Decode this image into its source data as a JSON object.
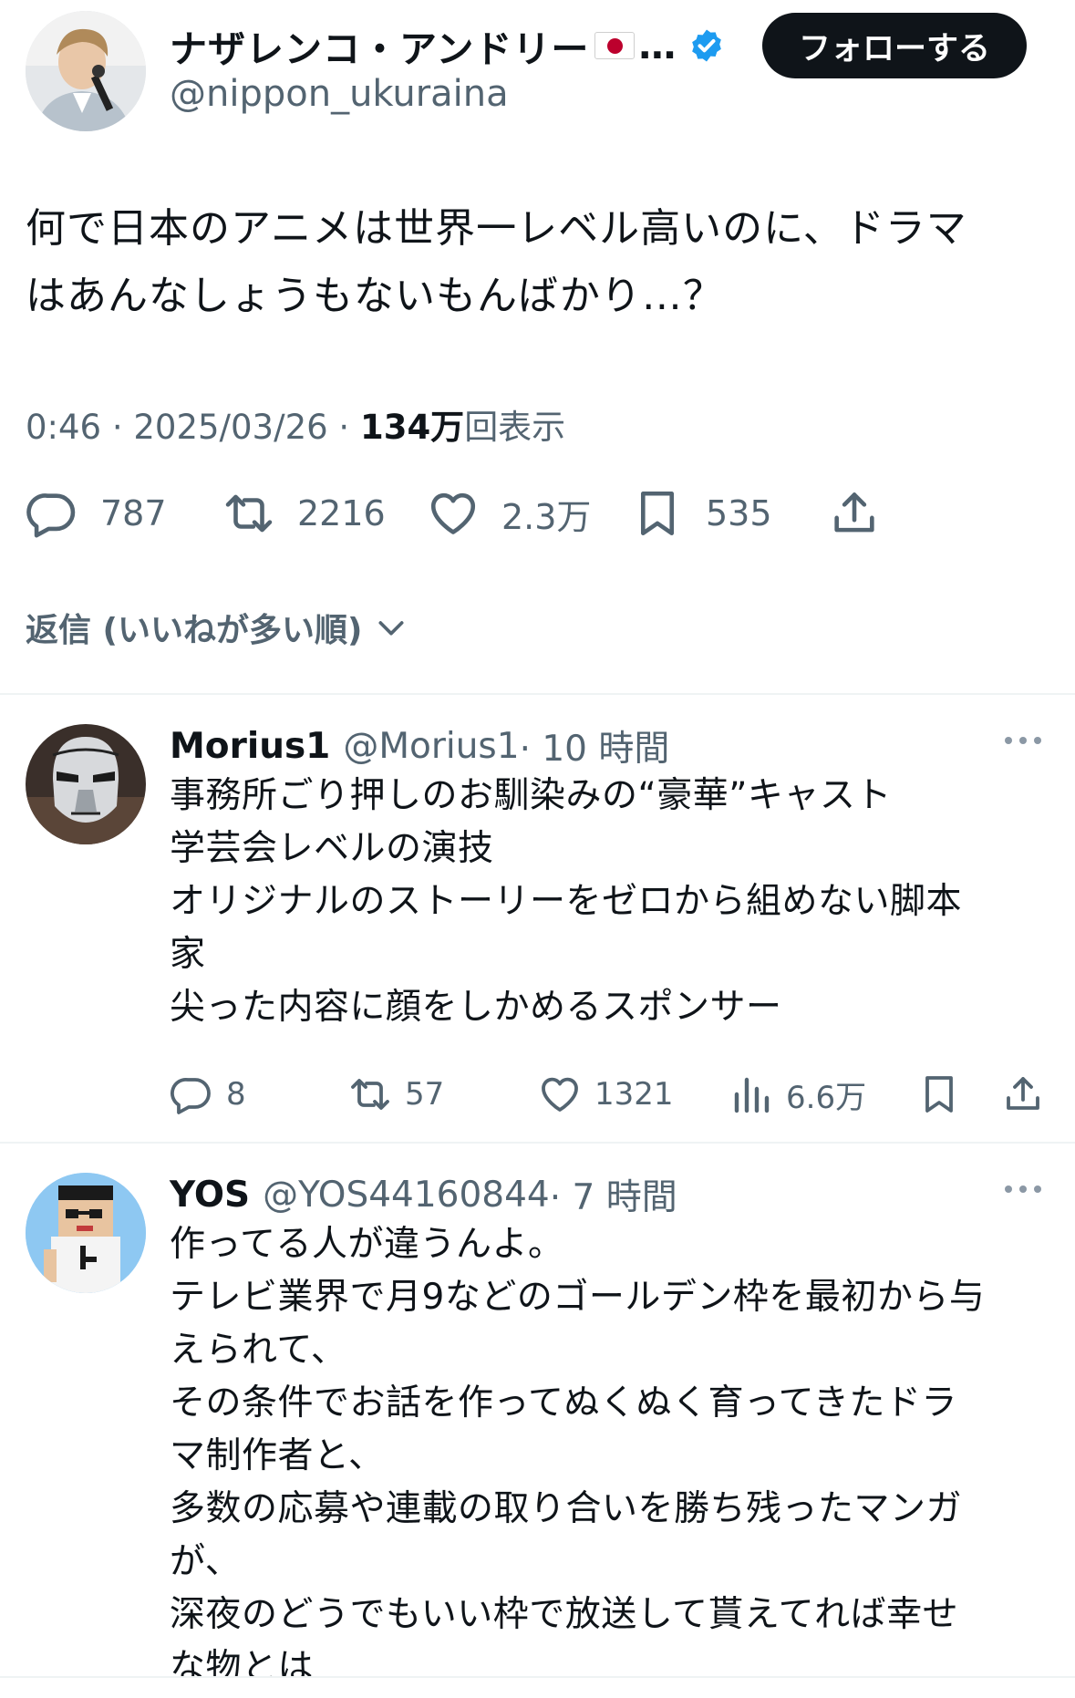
{
  "tweet": {
    "author": {
      "display_name": "ナザレンコ・アンドリー",
      "flag": "japan-flag",
      "ellipsis": "…",
      "verified": true,
      "username": "@nippon_ukuraina"
    },
    "follow_label": "フォローする",
    "text": "何で日本のアニメは世界一レベル高いのに、ドラマ\nはあんなしょうもないもんばかり…？",
    "time": "0:46",
    "date": "2025/03/26",
    "separator": " · ",
    "views_count": "134万",
    "views_label": "回表示",
    "actions": {
      "replies": "787",
      "retweets": "2216",
      "likes": "2.3万",
      "bookmarks": "535"
    },
    "accent_color": "#1d9bf0"
  },
  "sort": {
    "label": "返信 (いいねが多い順)"
  },
  "replies": [
    {
      "name": "Morius1",
      "handle": "@Morius1",
      "time": "· 10 時間",
      "text": "事務所ごり押しのお馴染みの“豪華”キャスト\n学芸会レベルの演技\nオリジナルのストーリーをゼロから組めない脚本\n家\n尖った内容に顔をしかめるスポンサー",
      "actions": {
        "replies": "8",
        "retweets": "57",
        "likes": "1321",
        "views": "6.6万"
      },
      "avatar_icon": "stormtrooper-avatar"
    },
    {
      "name": "YOS",
      "handle": "@YOS44160844",
      "time": "· 7 時間",
      "text": "作ってる人が違うんよ。\nテレビ業界で月9などのゴールデン枠を最初から与\nえられて、\nその条件でお話を作ってぬくぬく育ってきたドラ\nマ制作者と、\n多数の応募や連載の取り合いを勝ち残ったマンガ\nが、\n深夜のどうでもいい枠で放送して貰えてれば幸せ\nな物とは",
      "avatar_icon": "pixel-character-avatar"
    }
  ]
}
